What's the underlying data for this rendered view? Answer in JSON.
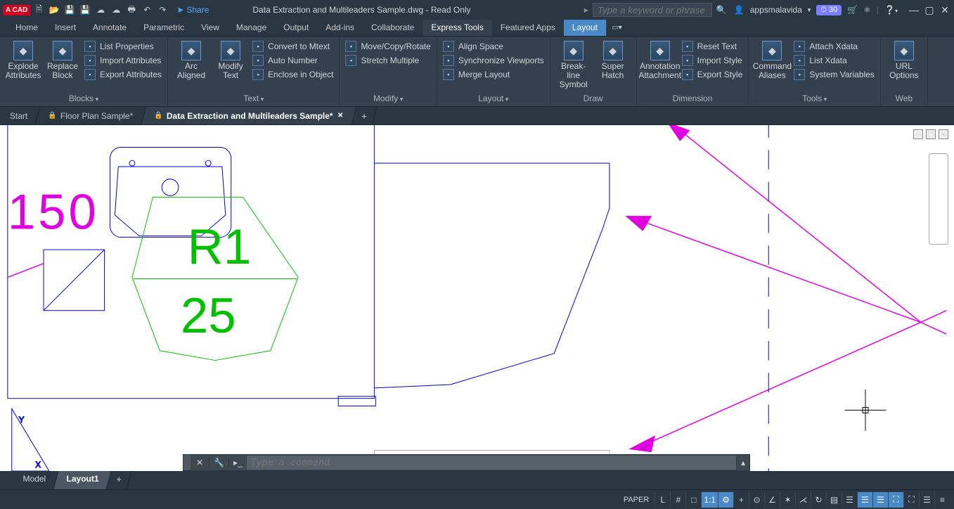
{
  "titlebar": {
    "brand": "A CAD",
    "share": "Share",
    "document_title": "Data Extraction and Multileaders Sample.dwg - Read Only",
    "search_placeholder": "Type a keyword or phrase",
    "username": "appsmalavida",
    "trial_badge": "⏱ 30"
  },
  "menu": {
    "items": [
      "Home",
      "Insert",
      "Annotate",
      "Parametric",
      "View",
      "Manage",
      "Output",
      "Add-ins",
      "Collaborate",
      "Express Tools",
      "Featured Apps",
      "Layout"
    ],
    "active": "Layout",
    "selected_context": "Express Tools"
  },
  "ribbon": {
    "panels": [
      {
        "title": "Blocks",
        "dropdown": true,
        "big": [
          {
            "label": "Explode\nAttributes"
          },
          {
            "label": "Replace\nBlock"
          }
        ],
        "small": [
          {
            "label": "List Properties"
          },
          {
            "label": "Import Attributes"
          },
          {
            "label": "Export Attributes"
          }
        ]
      },
      {
        "title": "Text",
        "dropdown": true,
        "big": [
          {
            "label": "Arc\nAligned"
          },
          {
            "label": "Modify\nText"
          }
        ],
        "small": [
          {
            "label": "Convert to Mtext"
          },
          {
            "label": "Auto Number"
          },
          {
            "label": "Enclose in Object"
          }
        ]
      },
      {
        "title": "Modify",
        "dropdown": true,
        "big": [],
        "small": [
          {
            "label": "Move/Copy/Rotate"
          },
          {
            "label": "Stretch Multiple"
          }
        ]
      },
      {
        "title": "Layout",
        "dropdown": true,
        "big": [],
        "small": [
          {
            "label": "Align Space"
          },
          {
            "label": "Synchronize Viewports"
          },
          {
            "label": "Merge Layout"
          }
        ]
      },
      {
        "title": "Draw",
        "dropdown": false,
        "big": [
          {
            "label": "Break-line\nSymbol"
          },
          {
            "label": "Super\nHatch"
          }
        ],
        "small": []
      },
      {
        "title": "Dimension",
        "dropdown": false,
        "big": [
          {
            "label": "Annotation\nAttachment"
          }
        ],
        "small": [
          {
            "label": "Reset Text"
          },
          {
            "label": "Import Style"
          },
          {
            "label": "Export Style"
          }
        ]
      },
      {
        "title": "Tools",
        "dropdown": true,
        "big": [
          {
            "label": "Command\nAliases"
          }
        ],
        "small": [
          {
            "label": "Attach Xdata"
          },
          {
            "label": "List Xdata"
          },
          {
            "label": "System Variables"
          }
        ]
      },
      {
        "title": "Web",
        "dropdown": false,
        "big": [
          {
            "label": "URL\nOptions"
          }
        ],
        "small": []
      }
    ]
  },
  "doc_tabs": {
    "items": [
      {
        "label": "Start",
        "locked": false,
        "active": false,
        "close": false
      },
      {
        "label": "Floor Plan Sample*",
        "locked": true,
        "active": false,
        "close": false
      },
      {
        "label": "Data Extraction and Multileaders Sample*",
        "locked": true,
        "active": true,
        "close": true
      }
    ]
  },
  "canvas": {
    "text_150": "150",
    "text_R1": "R1",
    "text_25": "25",
    "axis_x": "X",
    "axis_y": "Y"
  },
  "command": {
    "placeholder": "Type a command"
  },
  "bottom_tabs": {
    "items": [
      "Model",
      "Layout1"
    ],
    "active": "Layout1"
  },
  "statusbar": {
    "paper": "PAPER",
    "icons": [
      "L",
      "#",
      "□",
      "1:1",
      "⚙",
      "+",
      "⊙",
      "∠",
      "✶",
      "⋌",
      "↻",
      "▤",
      "☰",
      "☰",
      "☰",
      "⛶",
      "⛶",
      "☰",
      "≡"
    ]
  }
}
